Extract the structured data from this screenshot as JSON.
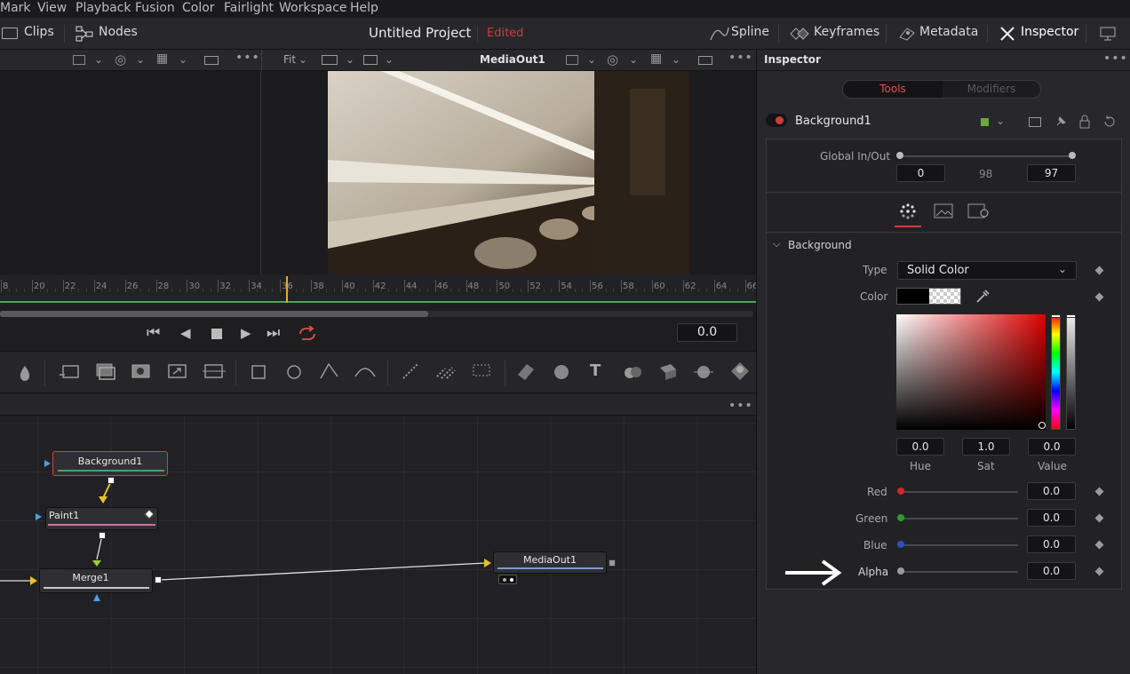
{
  "menu": [
    "Mark",
    "View",
    "Playback",
    "Fusion",
    "Color",
    "Fairlight",
    "Workspace",
    "Help"
  ],
  "topbar": {
    "clips": "Clips",
    "nodes": "Nodes",
    "project_title": "Untitled Project",
    "edited": "Edited",
    "spline": "Spline",
    "keyframes": "Keyframes",
    "metadata": "Metadata",
    "inspector": "Inspector"
  },
  "viewer": {
    "fit": "Fit",
    "name": "MediaOut1"
  },
  "ruler": {
    "ticks": [
      "8",
      "20",
      "22",
      "24",
      "26",
      "28",
      "30",
      "32",
      "34",
      "36",
      "38",
      "40",
      "42",
      "44",
      "46",
      "48",
      "50",
      "52",
      "54",
      "56",
      "58",
      "60",
      "62",
      "64",
      "66"
    ]
  },
  "transport": {
    "time": "0.0"
  },
  "nodes": {
    "background": "Background1",
    "paint": "Paint1",
    "merge": "Merge1",
    "mediaout": "MediaOut1"
  },
  "inspector": {
    "title": "Inspector",
    "tab_tools": "Tools",
    "tab_modifiers": "Modifiers",
    "tool_name": "Background1",
    "global_inout_label": "Global In/Out",
    "global_in": "0",
    "global_mid": "98",
    "global_out": "97",
    "section": "Background",
    "type_label": "Type",
    "type_value": "Solid Color",
    "color_label": "Color",
    "hue": "0.0",
    "sat": "1.0",
    "value": "0.0",
    "hue_label": "Hue",
    "sat_label": "Sat",
    "value_label": "Value",
    "channels": [
      {
        "label": "Red",
        "value": "0.0",
        "color": "#d02828"
      },
      {
        "label": "Green",
        "value": "0.0",
        "color": "#28a028"
      },
      {
        "label": "Blue",
        "value": "0.0",
        "color": "#2850c8"
      },
      {
        "label": "Alpha",
        "value": "0.0",
        "color": "#9a9a9a"
      }
    ]
  },
  "colors": {
    "accent_red": "#d33b3b",
    "panel": "#28282c"
  }
}
